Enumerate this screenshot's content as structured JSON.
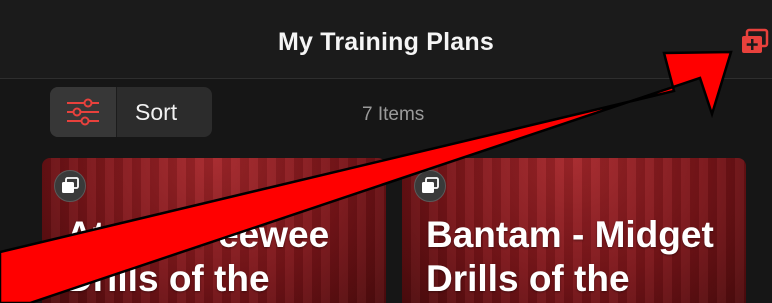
{
  "navbar": {
    "title": "My Training Plans",
    "add_icon": "add-plan-icon"
  },
  "toolbar": {
    "filter_icon": "sliders-icon",
    "sort_label": "Sort",
    "item_count": "7 Items"
  },
  "cards": [
    {
      "title": "Atom - Peewee Drills of the",
      "badge_icon": "stacked-plans-icon"
    },
    {
      "title": "Bantam - Midget Drills of the",
      "badge_icon": "stacked-plans-icon"
    }
  ],
  "annotation": {
    "arrow_color": "#ff0000",
    "points_to": "add-plan-button"
  },
  "colors": {
    "accent": "#e8413c",
    "background": "#161616",
    "card": "#8e1b1f"
  }
}
